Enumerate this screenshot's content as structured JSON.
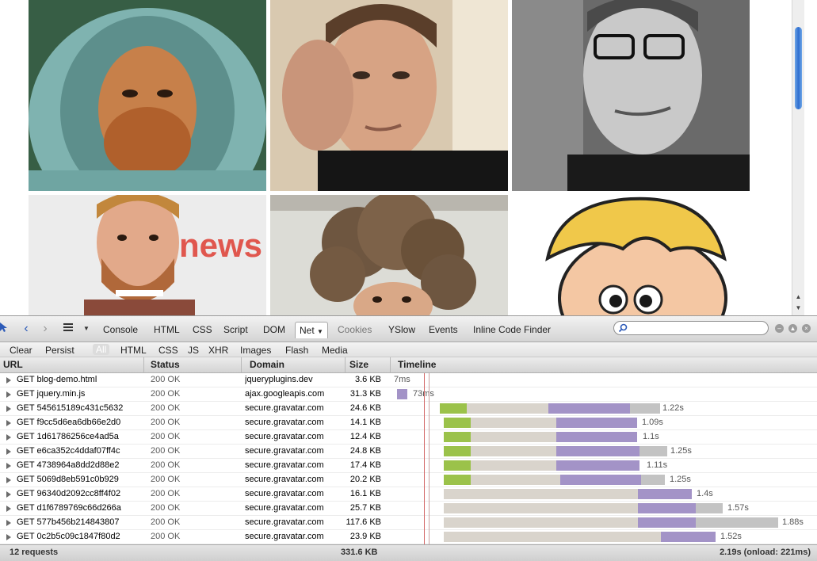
{
  "toolbar": {
    "tabs": [
      "Console",
      "HTML",
      "CSS",
      "Script",
      "DOM",
      "Net",
      "Cookies",
      "YSlow",
      "Events",
      "Inline Code Finder"
    ],
    "active_tab": "Net",
    "search_placeholder": ""
  },
  "filters": [
    "Clear",
    "Persist",
    "All",
    "HTML",
    "CSS",
    "JS",
    "XHR",
    "Images",
    "Flash",
    "Media"
  ],
  "columns": [
    "URL",
    "Status",
    "Domain",
    "Size",
    "Timeline"
  ],
  "requests": [
    {
      "url": "GET blog-demo.html",
      "status": "200 OK",
      "domain": "jqueryplugins.dev",
      "size": "3.6 KB",
      "time": "7ms"
    },
    {
      "url": "GET jquery.min.js",
      "status": "200 OK",
      "domain": "ajax.googleapis.com",
      "size": "31.3 KB",
      "time": "73ms"
    },
    {
      "url": "GET 545615189c431c5632",
      "status": "200 OK",
      "domain": "secure.gravatar.com",
      "size": "24.6 KB",
      "time": "1.22s"
    },
    {
      "url": "GET f9cc5d6ea6db66e2d0",
      "status": "200 OK",
      "domain": "secure.gravatar.com",
      "size": "14.1 KB",
      "time": "1.09s"
    },
    {
      "url": "GET 1d61786256ce4ad5a",
      "status": "200 OK",
      "domain": "secure.gravatar.com",
      "size": "12.4 KB",
      "time": "1.1s"
    },
    {
      "url": "GET e6ca352c4ddaf07ff4c",
      "status": "200 OK",
      "domain": "secure.gravatar.com",
      "size": "24.8 KB",
      "time": "1.25s"
    },
    {
      "url": "GET 4738964a8dd2d88e2",
      "status": "200 OK",
      "domain": "secure.gravatar.com",
      "size": "17.4 KB",
      "time": "1.11s"
    },
    {
      "url": "GET 5069d8eb591c0b929",
      "status": "200 OK",
      "domain": "secure.gravatar.com",
      "size": "20.2 KB",
      "time": "1.25s"
    },
    {
      "url": "GET 96340d2092cc8ff4f02",
      "status": "200 OK",
      "domain": "secure.gravatar.com",
      "size": "16.1 KB",
      "time": "1.4s"
    },
    {
      "url": "GET d1f6789769c66d266a",
      "status": "200 OK",
      "domain": "secure.gravatar.com",
      "size": "25.7 KB",
      "time": "1.57s"
    },
    {
      "url": "GET 577b456b214843807",
      "status": "200 OK",
      "domain": "secure.gravatar.com",
      "size": "117.6 KB",
      "time": "1.88s"
    },
    {
      "url": "GET 0c2b5c09c1847f80d2",
      "status": "200 OK",
      "domain": "secure.gravatar.com",
      "size": "23.9 KB",
      "time": "1.52s"
    }
  ],
  "footer": {
    "requests": "12 requests",
    "total_size": "331.6 KB",
    "total_time": "2.19s (onload: 221ms)"
  },
  "colors": {
    "timeline_blocking": "#9bc24a",
    "timeline_waiting": "#d9d4cc",
    "timeline_receiving": "#a393c7",
    "timeline_queued": "#c3c3c3",
    "search_icon_color": "#2d5bb8"
  }
}
